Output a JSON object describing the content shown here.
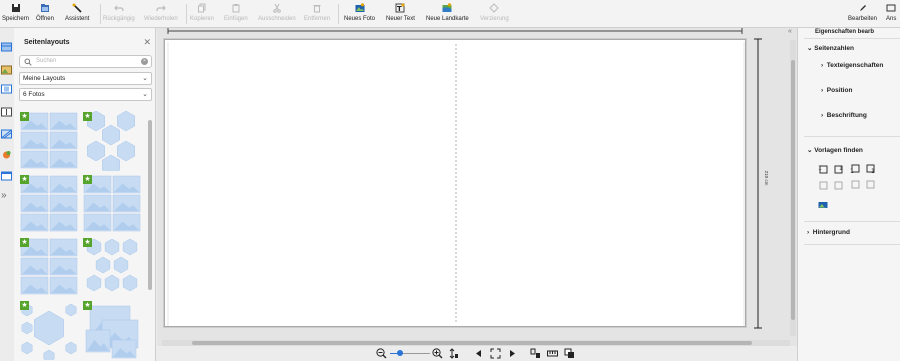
{
  "toolbar": {
    "items": [
      {
        "label": "Speichern",
        "icon": "save-icon",
        "enabled": true
      },
      {
        "label": "Öffnen",
        "icon": "open-icon",
        "enabled": true
      },
      {
        "label": "Assistent",
        "icon": "wand-icon",
        "enabled": true
      },
      {
        "label": "Rückgängig",
        "icon": "undo-icon",
        "enabled": false
      },
      {
        "label": "Wiederholen",
        "icon": "redo-icon",
        "enabled": false
      },
      {
        "label": "Kopieren",
        "icon": "copy-icon",
        "enabled": false
      },
      {
        "label": "Einfügen",
        "icon": "paste-icon",
        "enabled": false
      },
      {
        "label": "Ausschneiden",
        "icon": "cut-icon",
        "enabled": false
      },
      {
        "label": "Entfernen",
        "icon": "trash-icon",
        "enabled": false
      },
      {
        "label": "Neues Foto",
        "icon": "new-photo-icon",
        "enabled": true
      },
      {
        "label": "Neuer Text",
        "icon": "new-text-icon",
        "enabled": true
      },
      {
        "label": "Neue Landkarte",
        "icon": "new-map-icon",
        "enabled": true
      },
      {
        "label": "Verzierung",
        "icon": "ornament-icon",
        "enabled": false
      }
    ],
    "right_items": [
      {
        "label": "Bearbeiten",
        "icon": "edit-icon"
      },
      {
        "label": "Ans",
        "icon": "view-icon"
      }
    ]
  },
  "left_panel": {
    "title": "Seitenlayouts",
    "search_placeholder": "Suchen",
    "layout_select": "Meine Layouts",
    "count_select": "6 Fotos"
  },
  "canvas": {
    "page_dimension": "210 cm"
  },
  "right_panel": {
    "title": "Eigenschaften bearb",
    "sections": {
      "page_numbers": "Seitenzahlen",
      "text_properties": "Texteigenschaften",
      "position": "Position",
      "caption": "Beschriftung",
      "find_templates": "Vorlagen finden",
      "background": "Hintergrund"
    }
  },
  "colors": {
    "star_green": "#57a42d",
    "photo_placeholder": "#c7dcf3",
    "accent_blue": "#2a74d9"
  }
}
